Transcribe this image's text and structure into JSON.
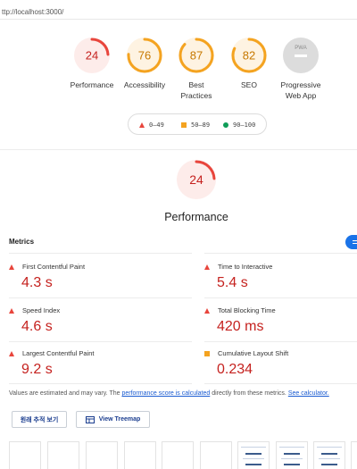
{
  "browser": {
    "url": "ttp://localhost:3000/"
  },
  "categories": [
    {
      "label": "Performance",
      "score": "24",
      "color": "#e8453c",
      "bg": "#fdecea",
      "fraction": 0.24
    },
    {
      "label": "Accessibility",
      "score": "76",
      "color": "#f4a320",
      "bg": "#fef3e2",
      "fraction": 0.76
    },
    {
      "label": "Best\nPractices",
      "score": "87",
      "color": "#f4a320",
      "bg": "#fef3e2",
      "fraction": 0.87
    },
    {
      "label": "SEO",
      "score": "82",
      "color": "#f4a320",
      "bg": "#fef3e2",
      "fraction": 0.82
    },
    {
      "label": "Progressive\nWeb App",
      "badge": "PWA"
    }
  ],
  "legend": {
    "fail": "0–49",
    "average": "50–89",
    "pass": "90–100"
  },
  "performance": {
    "score": "24",
    "title": "Performance",
    "fraction": 0.24
  },
  "metrics": {
    "heading": "Metrics",
    "items": [
      {
        "name": "First Contentful Paint",
        "value": "4.3 s",
        "status": "fail"
      },
      {
        "name": "Time to Interactive",
        "value": "5.4 s",
        "status": "fail"
      },
      {
        "name": "Speed Index",
        "value": "4.6 s",
        "status": "fail"
      },
      {
        "name": "Total Blocking Time",
        "value": "420 ms",
        "status": "fail"
      },
      {
        "name": "Largest Contentful Paint",
        "value": "9.2 s",
        "status": "fail"
      },
      {
        "name": "Cumulative Layout Shift",
        "value": "0.234",
        "status": "average"
      }
    ]
  },
  "note": {
    "prefix": "Values are estimated and may vary. The ",
    "link1": "performance score is calculated",
    "middle": " directly from these metrics. ",
    "link2": "See calculator."
  },
  "buttons": {
    "original_trace": "원래 추적 보기",
    "treemap": "View Treemap"
  },
  "colors": {
    "fail": "#e8453c",
    "average": "#f4a320",
    "pass": "#0f9d58",
    "accent": "#1a73e8"
  }
}
